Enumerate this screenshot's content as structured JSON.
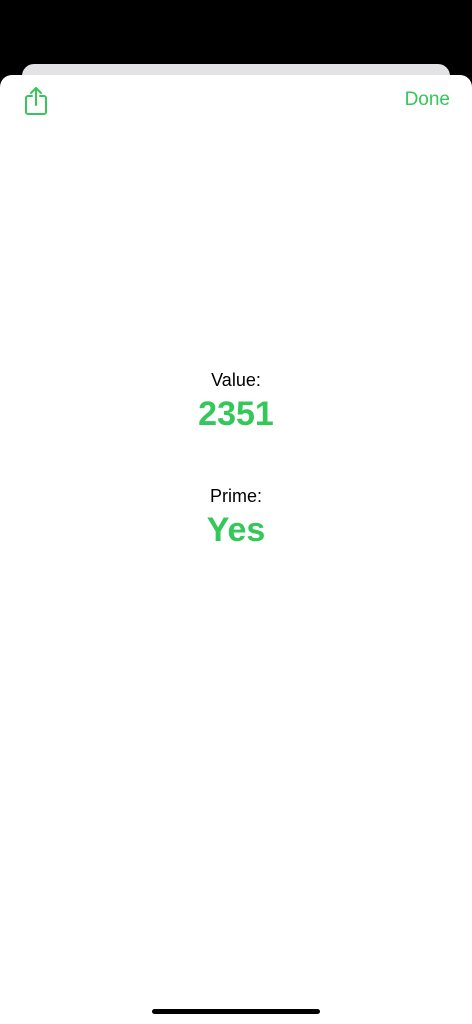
{
  "colors": {
    "accent": "#34c759",
    "text": "#000000",
    "sheet_background": "#ffffff"
  },
  "toolbar": {
    "share_icon": "share-icon",
    "done_label": "Done"
  },
  "result": {
    "value_label": "Value:",
    "value": "2351",
    "prime_label": "Prime:",
    "prime": "Yes"
  }
}
